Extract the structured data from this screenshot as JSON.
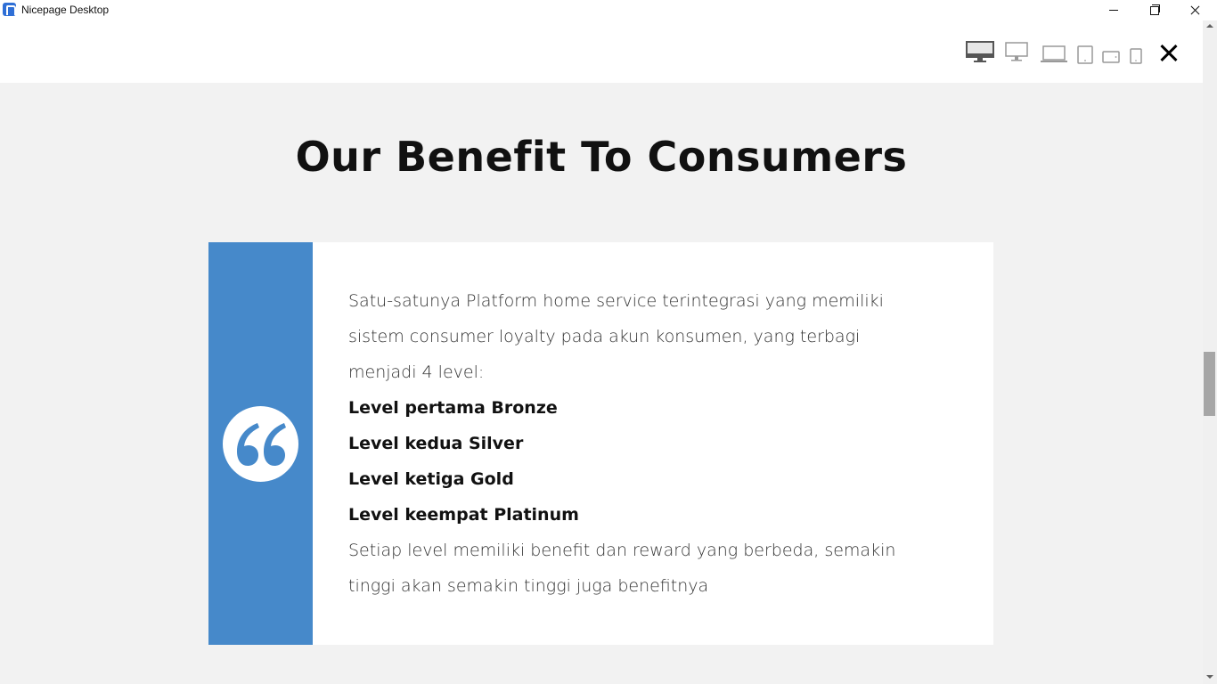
{
  "window": {
    "title": "Nicepage Desktop"
  },
  "toolbar": {
    "devices": [
      "desktop-large-icon",
      "desktop-icon",
      "laptop-icon",
      "tablet-icon",
      "tablet-landscape-icon",
      "phone-icon"
    ]
  },
  "section": {
    "heading": "Our Benefit To Consumers",
    "intro_lines": [
      "Satu-satunya Platform home service terintegrasi yang memiliki",
      "sistem consumer loyalty pada akun konsumen, yang terbagi",
      "menjadi 4 level:"
    ],
    "levels": [
      "Level pertama Bronze",
      "Level kedua Silver",
      "Level ketiga Gold",
      "Level keempat Platinum"
    ],
    "outro_lines": [
      "Setiap level memiliki benefit dan reward yang berbeda, semakin",
      "tinggi akan semakin tinggi juga benefitnya"
    ]
  },
  "colors": {
    "accent": "#4689ca",
    "background": "#f2f2f2",
    "card": "#ffffff",
    "heading": "#111111"
  }
}
